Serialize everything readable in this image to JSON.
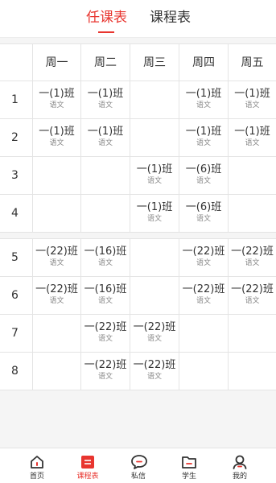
{
  "header": {
    "tabs": [
      {
        "label": "任课表",
        "active": true
      },
      {
        "label": "课程表",
        "active": false
      }
    ]
  },
  "table": {
    "days": [
      "周一",
      "周二",
      "周三",
      "周四",
      "周五"
    ],
    "rows": [
      {
        "period": "1",
        "cells": [
          {
            "class": "一(1)班",
            "subject": "语文"
          },
          {
            "class": "一(1)班",
            "subject": "语文"
          },
          null,
          {
            "class": "一(1)班",
            "subject": "语文"
          },
          {
            "class": "一(1)班",
            "subject": "语文"
          }
        ]
      },
      {
        "period": "2",
        "cells": [
          {
            "class": "一(1)班",
            "subject": "语文"
          },
          {
            "class": "一(1)班",
            "subject": "语文"
          },
          null,
          {
            "class": "一(1)班",
            "subject": "语文"
          },
          {
            "class": "一(1)班",
            "subject": "语文"
          }
        ]
      },
      {
        "period": "3",
        "cells": [
          null,
          null,
          {
            "class": "一(1)班",
            "subject": "语文"
          },
          {
            "class": "一(6)班",
            "subject": "语文"
          },
          null
        ]
      },
      {
        "period": "4",
        "cells": [
          null,
          null,
          {
            "class": "一(1)班",
            "subject": "语文"
          },
          {
            "class": "一(6)班",
            "subject": "语文"
          },
          null
        ]
      },
      {
        "period": "5",
        "cells": [
          {
            "class": "一(22)班",
            "subject": "语文"
          },
          {
            "class": "一(16)班",
            "subject": "语文"
          },
          null,
          {
            "class": "一(22)班",
            "subject": "语文"
          },
          {
            "class": "一(22)班",
            "subject": "语文"
          }
        ]
      },
      {
        "period": "6",
        "cells": [
          {
            "class": "一(22)班",
            "subject": "语文"
          },
          {
            "class": "一(16)班",
            "subject": "语文"
          },
          null,
          {
            "class": "一(22)班",
            "subject": "语文"
          },
          {
            "class": "一(22)班",
            "subject": "语文"
          }
        ]
      },
      {
        "period": "7",
        "cells": [
          null,
          {
            "class": "一(22)班",
            "subject": "语文"
          },
          {
            "class": "一(22)班",
            "subject": "语文"
          },
          null,
          null
        ]
      },
      {
        "period": "8",
        "cells": [
          null,
          {
            "class": "一(22)班",
            "subject": "语文"
          },
          {
            "class": "一(22)班",
            "subject": "语文"
          },
          null,
          null
        ]
      }
    ]
  },
  "tabbar": {
    "items": [
      {
        "label": "首页",
        "icon": "home-icon",
        "active": false
      },
      {
        "label": "课程表",
        "icon": "schedule-icon",
        "active": true
      },
      {
        "label": "私信",
        "icon": "message-icon",
        "active": false
      },
      {
        "label": "学生",
        "icon": "folder-icon",
        "active": false
      },
      {
        "label": "我的",
        "icon": "user-icon",
        "active": false
      }
    ]
  },
  "colors": {
    "accent": "#e8352f",
    "text": "#333333",
    "muted": "#888888",
    "border": "#e4e4e4"
  }
}
